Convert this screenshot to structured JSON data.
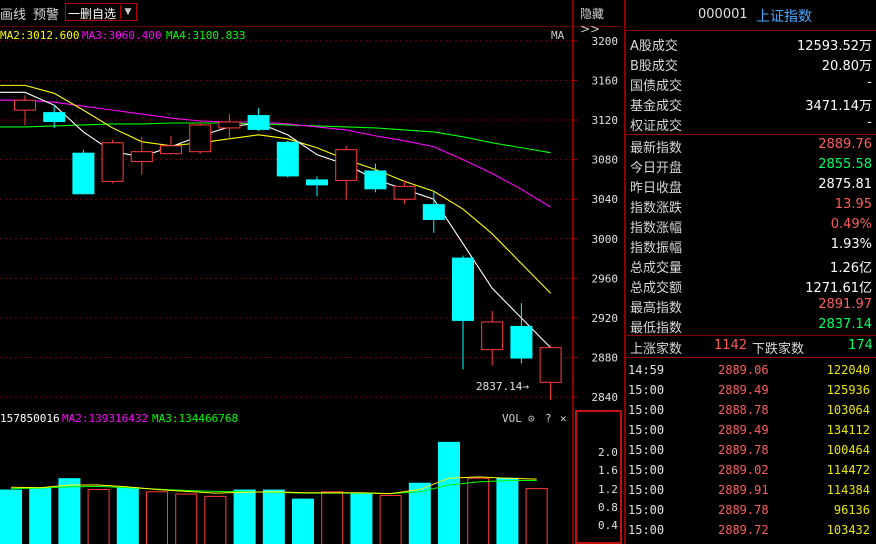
{
  "toolbar": {
    "item1": "画线",
    "item2": "预警",
    "select_value": "一删自选",
    "hide_label": "隐藏>>"
  },
  "ma_legend": {
    "ma2": "MA2:3012.600",
    "ma3": "MA3:3060.400",
    "ma4": "MA4:3100.833",
    "ma_tag": "MA"
  },
  "vol_legend": {
    "v1": "157850016",
    "ma2": "MA2:139316432",
    "ma3": "MA3:134466768",
    "vol_tag": "VOL",
    "icons": [
      "⊙",
      "?",
      "×"
    ]
  },
  "low_marker": "2837.14→",
  "colors": {
    "up": "#ff3c3c",
    "down": "#00ffff",
    "ma_white": "#ffffff",
    "ma_yellow": "#ffff00",
    "ma_magenta": "#ff00ff",
    "ma_green": "#00ff00",
    "grid": "#7a0000",
    "accent_blue": "#48a8ff"
  },
  "chart_data": [
    {
      "type": "candlestick",
      "yticks": [
        3200,
        3160,
        3120,
        3080,
        3040,
        3000,
        2960,
        2920,
        2880,
        2840
      ],
      "ylim": [
        2827,
        3215
      ],
      "candles": [
        {
          "o": 3130,
          "c": 3140,
          "h": 3145,
          "l": 3115
        },
        {
          "o": 3128,
          "c": 3118,
          "h": 3135,
          "l": 3112
        },
        {
          "o": 3087,
          "c": 3045,
          "h": 3090,
          "l": 3045
        },
        {
          "o": 3058,
          "c": 3097,
          "h": 3100,
          "l": 3056
        },
        {
          "o": 3078,
          "c": 3088,
          "h": 3103,
          "l": 3065
        },
        {
          "o": 3086,
          "c": 3094,
          "h": 3104,
          "l": 3085
        },
        {
          "o": 3088,
          "c": 3115,
          "h": 3117,
          "l": 3086
        },
        {
          "o": 3112,
          "c": 3118,
          "h": 3126,
          "l": 3100
        },
        {
          "o": 3125,
          "c": 3110,
          "h": 3132,
          "l": 3109
        },
        {
          "o": 3098,
          "c": 3063,
          "h": 3099,
          "l": 3062
        },
        {
          "o": 3060,
          "c": 3054,
          "h": 3063,
          "l": 3043
        },
        {
          "o": 3059,
          "c": 3090,
          "h": 3094,
          "l": 3039
        },
        {
          "o": 3069,
          "c": 3050,
          "h": 3076,
          "l": 3047
        },
        {
          "o": 3040,
          "c": 3053,
          "h": 3059,
          "l": 3035
        },
        {
          "o": 3035,
          "c": 3019,
          "h": 3048,
          "l": 3006
        },
        {
          "o": 2981,
          "c": 2917,
          "h": 2983,
          "l": 2868
        },
        {
          "o": 2888,
          "c": 2916,
          "h": 2927,
          "l": 2872
        },
        {
          "o": 2912,
          "c": 2879,
          "h": 2935,
          "l": 2874
        },
        {
          "o": 2855,
          "c": 2890,
          "h": 2892,
          "l": 2837
        }
      ],
      "ma_white": [
        3148,
        3135,
        3108,
        3088,
        3083,
        3093,
        3104,
        3113,
        3117,
        3105,
        3085,
        3075,
        3060,
        3050,
        3040,
        2995,
        2950,
        2920,
        2890
      ],
      "ma_yellow": [
        3155,
        3147,
        3130,
        3112,
        3098,
        3094,
        3097,
        3101,
        3105,
        3101,
        3092,
        3080,
        3070,
        3058,
        3048,
        3030,
        3005,
        2975,
        2945
      ],
      "ma_magenta": [
        3140,
        3138,
        3134,
        3130,
        3126,
        3122,
        3119,
        3118,
        3118,
        3116,
        3113,
        3110,
        3104,
        3099,
        3093,
        3080,
        3066,
        3050,
        3032
      ],
      "ma_green": [
        3113,
        3114,
        3115,
        3116,
        3116,
        3117,
        3117,
        3117,
        3116,
        3115,
        3114,
        3113,
        3112,
        3110,
        3108,
        3103,
        3097,
        3092,
        3087
      ]
    },
    {
      "type": "bar",
      "title": "VOL",
      "yticks": [
        "2.0",
        "1.6",
        "1.2",
        "0.8",
        "0.4"
      ],
      "ylim": [
        0,
        2.6
      ],
      "values": [
        1.2,
        1.25,
        1.45,
        1.2,
        1.25,
        1.15,
        1.1,
        1.05,
        1.2,
        1.2,
        1.0,
        1.15,
        1.12,
        1.07,
        1.35,
        2.25,
        1.45,
        1.46,
        1.22
      ],
      "directions": [
        "down",
        "down",
        "down",
        "up",
        "down",
        "up",
        "up",
        "up",
        "down",
        "down",
        "down",
        "up",
        "down",
        "up",
        "down",
        "down",
        "up",
        "down",
        "up"
      ],
      "ma_yellow": [
        1.25,
        1.24,
        1.3,
        1.3,
        1.26,
        1.2,
        1.16,
        1.12,
        1.14,
        1.15,
        1.13,
        1.13,
        1.13,
        1.11,
        1.2,
        1.45,
        1.48,
        1.45,
        1.43
      ],
      "ma_green": [
        1.22,
        1.23,
        1.26,
        1.27,
        1.24,
        1.21,
        1.18,
        1.16,
        1.15,
        1.14,
        1.12,
        1.12,
        1.12,
        1.11,
        1.15,
        1.3,
        1.37,
        1.4,
        1.4
      ]
    }
  ],
  "right_panel": {
    "code": "000001",
    "name": "上证指数",
    "stats": [
      {
        "label": "A股成交",
        "value": "12593.52万",
        "color": "#ffffff"
      },
      {
        "label": "B股成交",
        "value": "20.80万",
        "color": "#ffffff"
      },
      {
        "label": "国债成交",
        "value": "-",
        "color": "#ffffff"
      },
      {
        "label": "基金成交",
        "value": "3471.14万",
        "color": "#ffffff"
      },
      {
        "label": "权证成交",
        "value": "-",
        "color": "#ffffff"
      }
    ],
    "quote": [
      {
        "label": "最新指数",
        "value": "2889.76",
        "color": "#ff5c5c"
      },
      {
        "label": "今日开盘",
        "value": "2855.58",
        "color": "#00ff66"
      },
      {
        "label": "昨日收盘",
        "value": "2875.81",
        "color": "#ffffff"
      },
      {
        "label": "指数涨跌",
        "value": "13.95",
        "color": "#ff5c5c"
      },
      {
        "label": "指数涨幅",
        "value": "0.49%",
        "color": "#ff5c5c"
      },
      {
        "label": "指数振幅",
        "value": "1.93%",
        "color": "#ffffff"
      },
      {
        "label": "总成交量",
        "value": "1.26亿",
        "color": "#ffffff"
      },
      {
        "label": "总成交额",
        "value": "1271.61亿",
        "color": "#ffffff"
      },
      {
        "label": "最高指数",
        "value": "2891.97",
        "color": "#ff5c5c"
      },
      {
        "label": "最低指数",
        "value": "2837.14",
        "color": "#00ff66"
      }
    ],
    "breadth": {
      "up_label": "上涨家数",
      "up_value": "1142",
      "down_label": "下跌家数",
      "down_value": "174"
    },
    "trades": [
      {
        "time": "14:59",
        "price": "2889.06",
        "vol": "122040"
      },
      {
        "time": "15:00",
        "price": "2889.49",
        "vol": "125936"
      },
      {
        "time": "15:00",
        "price": "2888.78",
        "vol": "103064"
      },
      {
        "time": "15:00",
        "price": "2889.49",
        "vol": "134112"
      },
      {
        "time": "15:00",
        "price": "2889.78",
        "vol": "100464"
      },
      {
        "time": "15:00",
        "price": "2889.02",
        "vol": "114472"
      },
      {
        "time": "15:00",
        "price": "2889.91",
        "vol": "114384"
      },
      {
        "time": "15:00",
        "price": "2889.78",
        "vol": "96136"
      },
      {
        "time": "15:00",
        "price": "2889.72",
        "vol": "103432"
      }
    ]
  }
}
